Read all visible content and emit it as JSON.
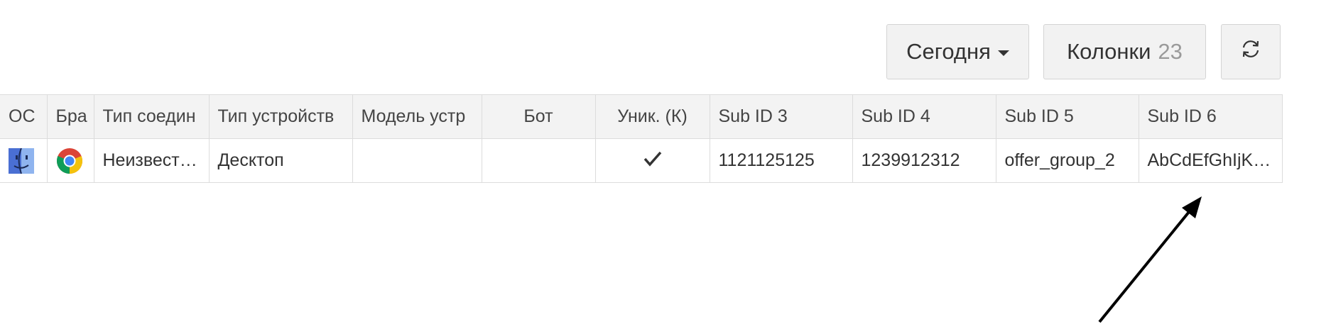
{
  "toolbar": {
    "date_label": "Сегодня",
    "columns_label": "Колонки",
    "columns_count": "23",
    "refresh_icon": "refresh-icon"
  },
  "table": {
    "headers": [
      "ОС",
      "Бра",
      "Тип соедин",
      "Тип устройств",
      "Модель устр",
      "Бот",
      "Уник. (К)",
      "Sub ID 3",
      "Sub ID 4",
      "Sub ID 5",
      "Sub ID 6"
    ],
    "row": {
      "os_icon": "macos-finder-icon",
      "browser_icon": "chrome-icon",
      "connection_type": "Неизвест…",
      "device_type": "Десктоп",
      "device_model": "",
      "bot": "",
      "unique_icon": "checkmark-icon",
      "sub_id_3": "1121125125",
      "sub_id_4": "1239912312",
      "sub_id_5": "offer_group_2",
      "sub_id_6": "AbCdEfGhIjKl…"
    }
  },
  "annotation": {
    "arrow_color": "#000000"
  }
}
